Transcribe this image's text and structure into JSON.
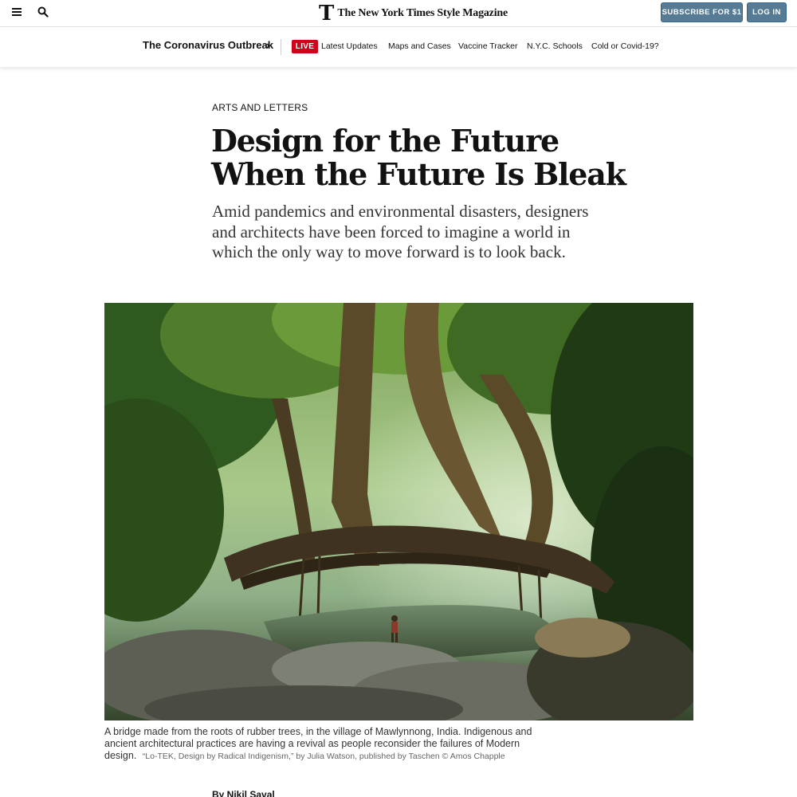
{
  "header": {
    "brand_mark": "T",
    "brand_name": "The New York Times Style Magazine",
    "subscribe_label": "SUBSCRIBE FOR $1",
    "login_label": "LOG IN"
  },
  "covid_nav": {
    "title": "The Coronavirus Outbreak",
    "chevron": "›",
    "live_label": "LIVE",
    "links": [
      "Latest Updates",
      "Maps and Cases",
      "Vaccine Tracker",
      "N.Y.C. Schools",
      "Cold or Covid-19?"
    ]
  },
  "article": {
    "kicker": "ARTS AND LETTERS",
    "headline": "Design for the Future When the Future Is Bleak",
    "dek": "Amid pandemics and environmental disasters, designers and architects have been forced to imagine a world in which the only way to move forward is to look back.",
    "caption": "A bridge made from the roots of rubber trees, in the village of Mawlynnong, India. Indigenous and ancient architectural practices are having a revival as people reconsider the failures of Modern design.",
    "credit": "“Lo-TEK, Design by Radical Indigenism,” by Julia Watson, published by Taschen © Amos Chapple",
    "byline": "By Nikil Saval"
  },
  "colors": {
    "button_blue": "#567b95",
    "live_red": "#d0021b",
    "text": "#121212"
  },
  "icons": [
    "menu-icon",
    "search-icon"
  ]
}
